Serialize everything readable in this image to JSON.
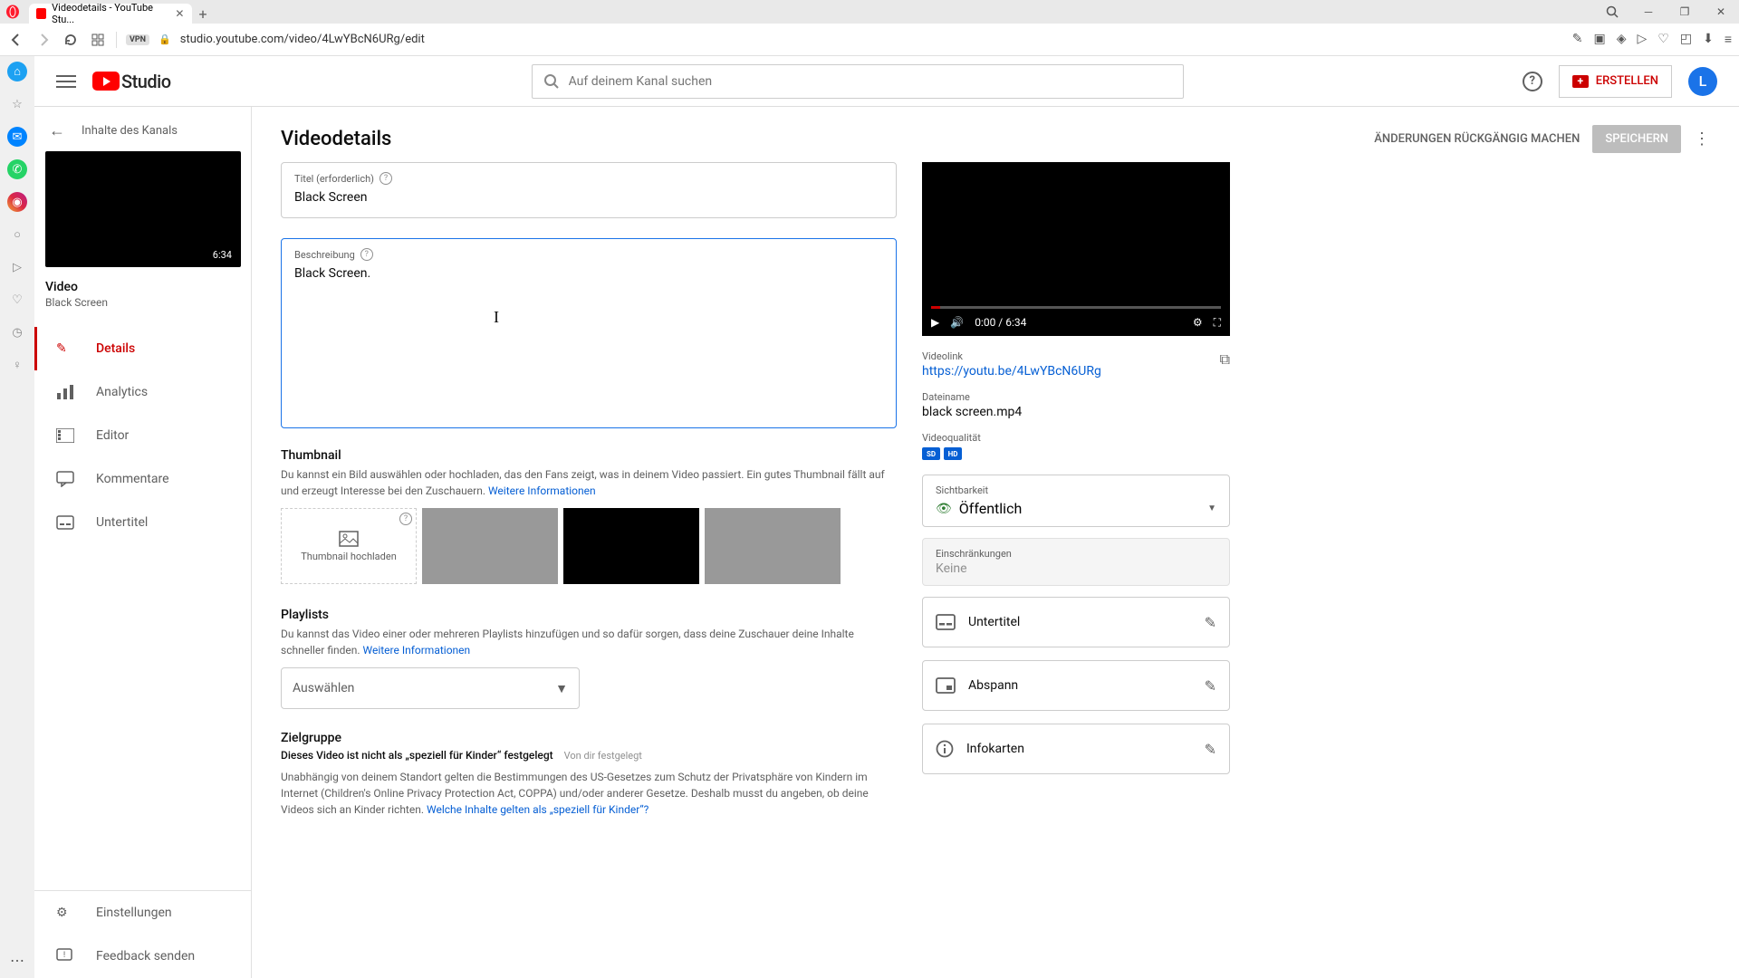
{
  "browser": {
    "tab_title": "Videodetails - YouTube Stu...",
    "url": "studio.youtube.com/video/4LwYBcN6URg/edit",
    "vpn": "VPN"
  },
  "header": {
    "studio_label": "Studio",
    "search_placeholder": "Auf deinem Kanal suchen",
    "create_label": "ERSTELLEN",
    "avatar_initial": "L"
  },
  "sidebar": {
    "back_label": "Inhalte des Kanals",
    "thumb_duration": "6:34",
    "video_label": "Video",
    "video_subtitle": "Black Screen",
    "nav": [
      {
        "label": "Details"
      },
      {
        "label": "Analytics"
      },
      {
        "label": "Editor"
      },
      {
        "label": "Kommentare"
      },
      {
        "label": "Untertitel"
      }
    ],
    "settings_label": "Einstellungen",
    "feedback_label": "Feedback senden"
  },
  "main": {
    "title": "Videodetails",
    "undo_label": "ÄNDERUNGEN RÜCKGÄNGIG MACHEN",
    "save_label": "SPEICHERN",
    "fields": {
      "title_label": "Titel (erforderlich)",
      "title_value": "Black Screen",
      "desc_label": "Beschreibung",
      "desc_value": "Black Screen."
    },
    "thumbnail": {
      "heading": "Thumbnail",
      "desc": "Du kannst ein Bild auswählen oder hochladen, das den Fans zeigt, was in deinem Video passiert. Ein gutes Thumbnail fällt auf und erzeugt Interesse bei den Zuschauern. ",
      "more": "Weitere Informationen",
      "upload_label": "Thumbnail hochladen"
    },
    "playlists": {
      "heading": "Playlists",
      "desc": "Du kannst das Video einer oder mehreren Playlists hinzufügen und so dafür sorgen, dass deine Zuschauer deine Inhalte schneller finden. ",
      "more": "Weitere Informationen",
      "select_placeholder": "Auswählen"
    },
    "audience": {
      "heading": "Zielgruppe",
      "status": "Dieses Video ist nicht als „speziell für Kinder“ festgelegt",
      "by": "Von dir festgelegt",
      "text": "Unabhängig von deinem Standort gelten die Bestimmungen des US-Gesetzes zum Schutz der Privatsphäre von Kindern im Internet (Children's Online Privacy Protection Act, COPPA) und/oder anderer Gesetze. Deshalb musst du angeben, ob deine Videos sich an Kinder richten. ",
      "link": "Welche Inhalte gelten als „speziell für Kinder“?"
    }
  },
  "right": {
    "player_time": "0:00 / 6:34",
    "videolink_label": "Videolink",
    "videolink": "https://youtu.be/4LwYBcN6URg",
    "filename_label": "Dateiname",
    "filename": "black screen.mp4",
    "quality_label": "Videoqualität",
    "sd": "SD",
    "hd": "HD",
    "visibility_label": "Sichtbarkeit",
    "visibility_value": "Öffentlich",
    "restrictions_label": "Einschränkungen",
    "restrictions_value": "Keine",
    "subtitles": "Untertitel",
    "endscreen": "Abspann",
    "infocards": "Infokarten"
  }
}
